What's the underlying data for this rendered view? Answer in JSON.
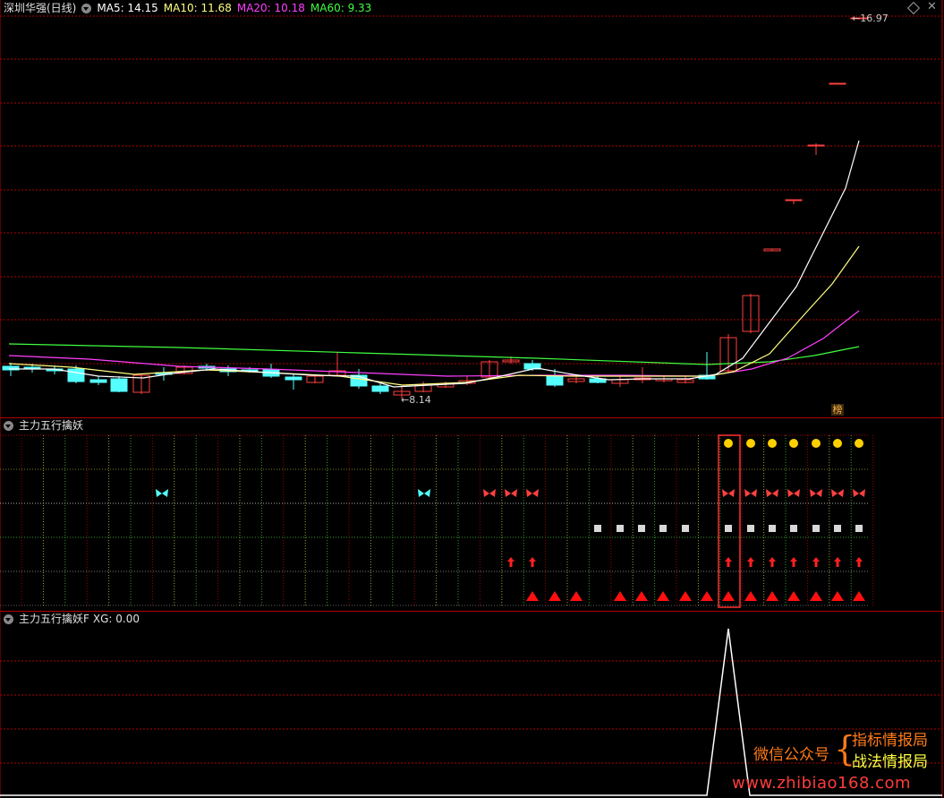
{
  "header": {
    "stock_name": "深圳华强(日线)",
    "ma5": "MA5: 14.15",
    "ma10": "MA10: 11.68",
    "ma20": "MA20: 10.18",
    "ma60": "MA60: 9.33",
    "high_marker": "16.97",
    "low_marker": "8.14",
    "rank_badge": "榜"
  },
  "colors": {
    "up": "#ff4040",
    "down": "#54ffff",
    "ma5": "#ffffff",
    "ma10": "#ffff80",
    "ma20": "#ff40ff",
    "ma60": "#40ff40",
    "grid": "#b00000"
  },
  "indicator1": {
    "title": "主力五行擒妖"
  },
  "indicator2": {
    "title": "主力五行擒妖F",
    "xg": "XG: 0.00"
  },
  "watermark": {
    "wechat": "微信公众号",
    "line1": "指标情报局",
    "line2": "战法情报局",
    "url": "www.zhibiao168.com"
  }
}
